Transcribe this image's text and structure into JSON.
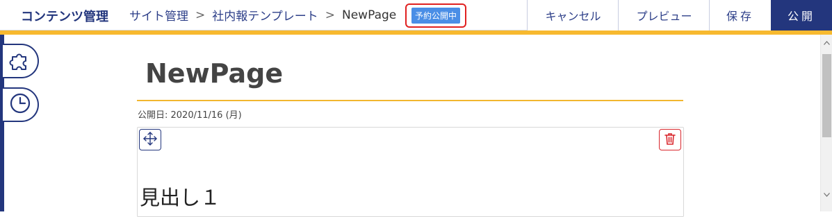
{
  "header": {
    "brand": "コンテンツ管理",
    "breadcrumb": [
      "サイト管理",
      "社内報テンプレート",
      "NewPage"
    ],
    "separator": ">",
    "status_badge": "予約公開中",
    "buttons": {
      "cancel": "キャンセル",
      "preview": "プレビュー",
      "save": "保存",
      "publish": "公開"
    }
  },
  "sidebar": {
    "tabs": [
      {
        "icon": "puzzle-icon"
      },
      {
        "icon": "clock-icon"
      }
    ]
  },
  "page": {
    "title": "NewPage",
    "publish_date": "公開日: 2020/11/16 (月)"
  },
  "block": {
    "heading": "見出し１"
  },
  "colors": {
    "primary": "#23367d",
    "accent": "#f7b92f",
    "badge": "#4a8ee6",
    "danger": "#d9262c"
  }
}
